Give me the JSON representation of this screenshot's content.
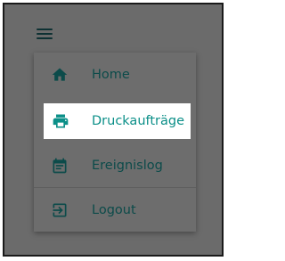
{
  "menu": {
    "items": [
      {
        "label": "Home",
        "icon": "home-icon"
      },
      {
        "label": "Druckaufträge",
        "icon": "printer-icon",
        "active": true
      },
      {
        "label": "Ereignislog",
        "icon": "calendar-icon"
      },
      {
        "label": "Logout",
        "icon": "logout-icon"
      }
    ]
  },
  "colors": {
    "accent": "#0b8f88",
    "dim_text": "#0c4b4a",
    "overlay": "#6b6b6b",
    "highlight_bg": "#ffffff"
  }
}
